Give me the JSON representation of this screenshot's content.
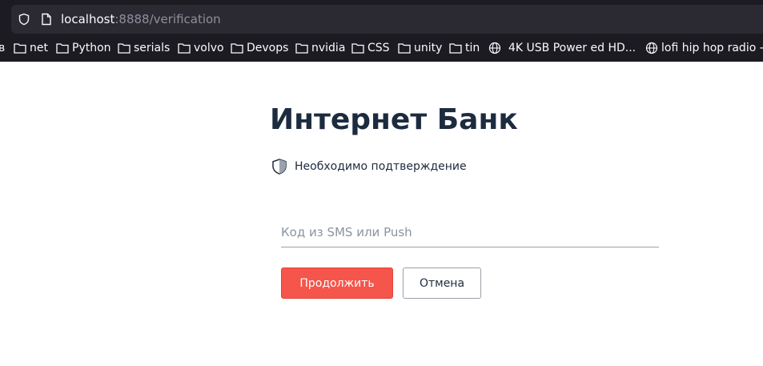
{
  "browser": {
    "url_host": "localhost",
    "url_rest": ":8888/verification",
    "bookmarks": [
      {
        "label": "в",
        "icon": "folder-icon"
      },
      {
        "label": "net",
        "icon": "folder-icon"
      },
      {
        "label": "Python",
        "icon": "folder-icon"
      },
      {
        "label": "serials",
        "icon": "folder-icon"
      },
      {
        "label": "volvo",
        "icon": "folder-icon"
      },
      {
        "label": "Devops",
        "icon": "folder-icon"
      },
      {
        "label": "nvidia",
        "icon": "folder-icon"
      },
      {
        "label": "CSS",
        "icon": "folder-icon"
      },
      {
        "label": "unity",
        "icon": "folder-icon"
      },
      {
        "label": "tin",
        "icon": "folder-icon"
      },
      {
        "label": "4K USB Power ed HD...",
        "icon": "globe-icon"
      },
      {
        "label": "lofi hip hop radio - b",
        "icon": "globe-icon"
      }
    ]
  },
  "page": {
    "title": "Интернет Банк",
    "notice": "Необходимо подтверждение",
    "code_placeholder": "Код из SMS или Push",
    "code_value": "",
    "continue_label": "Продолжить",
    "cancel_label": "Отмена"
  },
  "colors": {
    "browser_bg": "#1c1b22",
    "urlbar_bg": "#2b2a33",
    "title_color": "#1d2b3f",
    "primary_button": "#f5554a"
  }
}
